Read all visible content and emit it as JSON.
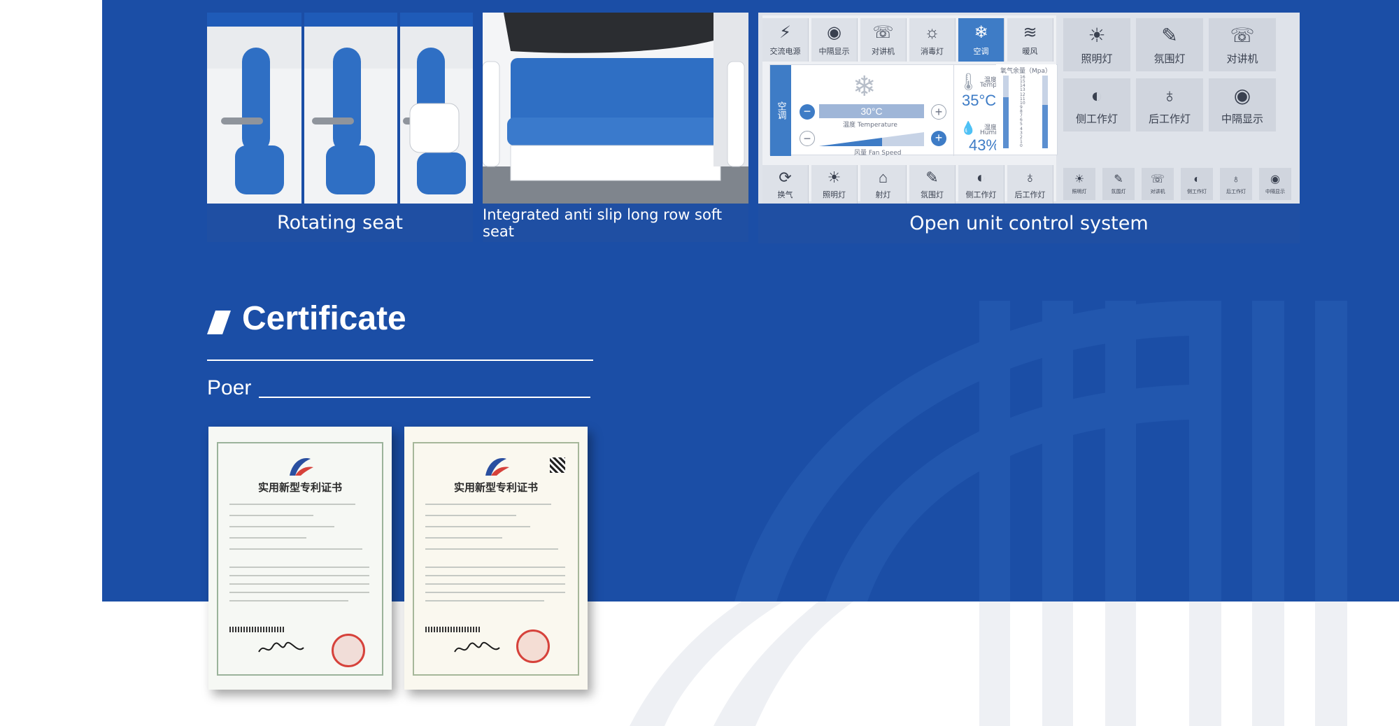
{
  "features": [
    {
      "caption": "Rotating seat"
    },
    {
      "caption": "Integrated anti slip long row soft seat"
    },
    {
      "caption": "Open unit control system"
    }
  ],
  "control_panel": {
    "top_tabs": [
      {
        "label": "交流电源",
        "icon": "bolt-icon"
      },
      {
        "label": "中隔显示",
        "icon": "eye-icon"
      },
      {
        "label": "对讲机",
        "icon": "walkie-talkie-icon"
      },
      {
        "label": "消毒灯",
        "icon": "uv-lamp-icon"
      },
      {
        "label": "空调",
        "icon": "snowflake-icon"
      },
      {
        "label": "暖风",
        "icon": "heat-icon"
      }
    ],
    "ac_side_label": "空调",
    "set_temperature": "30°C",
    "set_temperature_label": "温度 Temperature",
    "fan_speed_label": "风量 Fan Speed",
    "temperature_label": "温度",
    "temperature_label_en": "Temperature",
    "temperature_value": "35°C",
    "humidity_label": "湿度",
    "humidity_label_en": "Humidity",
    "humidity_value": "43%",
    "oxygen_label": "氧气余量（Mpa）",
    "oxygen_scale": [
      "16",
      "15",
      "14",
      "13",
      "12",
      "11",
      "10",
      "9",
      "8",
      "7",
      "6",
      "5",
      "4",
      "3",
      "2",
      "1",
      "0"
    ],
    "bottom_tabs": [
      {
        "label": "换气",
        "icon": "refresh-icon"
      },
      {
        "label": "照明灯",
        "icon": "bulb-icon"
      },
      {
        "label": "射灯",
        "icon": "spotlight-icon"
      },
      {
        "label": "氛围灯",
        "icon": "ambient-light-icon"
      },
      {
        "label": "侧工作灯",
        "icon": "side-lamp-icon"
      },
      {
        "label": "后工作灯",
        "icon": "rear-lamp-icon"
      }
    ],
    "right_tiles": [
      {
        "label": "照明灯",
        "icon": "bulb-icon"
      },
      {
        "label": "氛围灯",
        "icon": "ambient-light-icon"
      },
      {
        "label": "对讲机",
        "icon": "walkie-talkie-icon"
      },
      {
        "label": "侧工作灯",
        "icon": "side-lamp-icon"
      },
      {
        "label": "后工作灯",
        "icon": "rear-lamp-icon"
      },
      {
        "label": "中隔显示",
        "icon": "eye-icon"
      }
    ],
    "right_minis": [
      {
        "label": "照明灯",
        "icon": "bulb-icon"
      },
      {
        "label": "氛围灯",
        "icon": "ambient-light-icon"
      },
      {
        "label": "对讲机",
        "icon": "walkie-talkie-icon"
      },
      {
        "label": "侧工作灯",
        "icon": "side-lamp-icon"
      },
      {
        "label": "后工作灯",
        "icon": "rear-lamp-icon"
      },
      {
        "label": "中隔显示",
        "icon": "eye-icon"
      }
    ]
  },
  "certificate": {
    "title": "Certificate",
    "subtitle": "Poer",
    "documents": [
      {
        "title": "实用新型专利证书"
      },
      {
        "title": "实用新型专利证书"
      }
    ]
  },
  "colors": {
    "brand_blue": "#1b4ea6",
    "seat_blue": "#2f6fc4",
    "accent_blue": "#3e7cc6",
    "seal_red": "#d6423b"
  }
}
